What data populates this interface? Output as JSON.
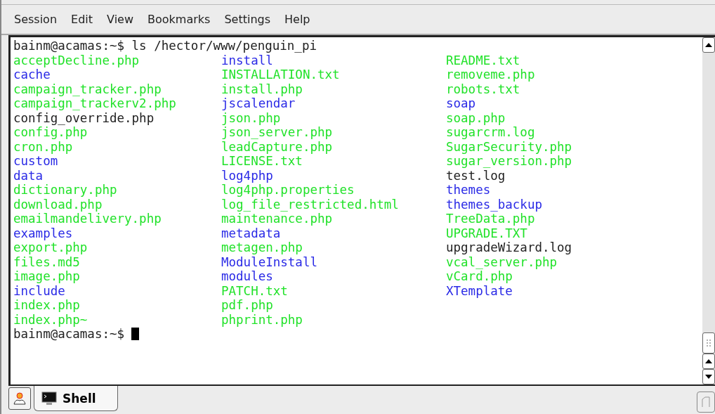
{
  "menu": [
    "Session",
    "Edit",
    "View",
    "Bookmarks",
    "Settings",
    "Help"
  ],
  "terminal": {
    "command_line": "bainm@acamas:~$ ls /hector/www/penguin_pi",
    "prompt": "bainm@acamas:~$",
    "columns": [
      [
        {
          "name": "acceptDecline.php",
          "color": "#22e22a"
        },
        {
          "name": "cache",
          "color": "#2a2ae6"
        },
        {
          "name": "campaign_tracker.php",
          "color": "#22e22a"
        },
        {
          "name": "campaign_trackerv2.php",
          "color": "#22e22a"
        },
        {
          "name": "config_override.php",
          "color": "#222222"
        },
        {
          "name": "config.php",
          "color": "#22e22a"
        },
        {
          "name": "cron.php",
          "color": "#22e22a"
        },
        {
          "name": "custom",
          "color": "#2a2ae6"
        },
        {
          "name": "data",
          "color": "#2a2ae6"
        },
        {
          "name": "dictionary.php",
          "color": "#22e22a"
        },
        {
          "name": "download.php",
          "color": "#22e22a"
        },
        {
          "name": "emailmandelivery.php",
          "color": "#22e22a"
        },
        {
          "name": "examples",
          "color": "#2a2ae6"
        },
        {
          "name": "export.php",
          "color": "#22e22a"
        },
        {
          "name": "files.md5",
          "color": "#22e22a"
        },
        {
          "name": "image.php",
          "color": "#22e22a"
        },
        {
          "name": "include",
          "color": "#2a2ae6"
        },
        {
          "name": "index.php",
          "color": "#22e22a"
        },
        {
          "name": "index.php~",
          "color": "#22e22a"
        }
      ],
      [
        {
          "name": "install",
          "color": "#2a2ae6"
        },
        {
          "name": "INSTALLATION.txt",
          "color": "#22e22a"
        },
        {
          "name": "install.php",
          "color": "#22e22a"
        },
        {
          "name": "jscalendar",
          "color": "#2a2ae6"
        },
        {
          "name": "json.php",
          "color": "#22e22a"
        },
        {
          "name": "json_server.php",
          "color": "#22e22a"
        },
        {
          "name": "leadCapture.php",
          "color": "#22e22a"
        },
        {
          "name": "LICENSE.txt",
          "color": "#22e22a"
        },
        {
          "name": "log4php",
          "color": "#2a2ae6"
        },
        {
          "name": "log4php.properties",
          "color": "#22e22a"
        },
        {
          "name": "log_file_restricted.html",
          "color": "#22e22a"
        },
        {
          "name": "maintenance.php",
          "color": "#22e22a"
        },
        {
          "name": "metadata",
          "color": "#2a2ae6"
        },
        {
          "name": "metagen.php",
          "color": "#22e22a"
        },
        {
          "name": "ModuleInstall",
          "color": "#2a2ae6"
        },
        {
          "name": "modules",
          "color": "#2a2ae6"
        },
        {
          "name": "PATCH.txt",
          "color": "#22e22a"
        },
        {
          "name": "pdf.php",
          "color": "#22e22a"
        },
        {
          "name": "phprint.php",
          "color": "#22e22a"
        }
      ],
      [
        {
          "name": "README.txt",
          "color": "#22e22a"
        },
        {
          "name": "removeme.php",
          "color": "#22e22a"
        },
        {
          "name": "robots.txt",
          "color": "#22e22a"
        },
        {
          "name": "soap",
          "color": "#2a2ae6"
        },
        {
          "name": "soap.php",
          "color": "#22e22a"
        },
        {
          "name": "sugarcrm.log",
          "color": "#22e22a"
        },
        {
          "name": "SugarSecurity.php",
          "color": "#22e22a"
        },
        {
          "name": "sugar_version.php",
          "color": "#22e22a"
        },
        {
          "name": "test.log",
          "color": "#222222"
        },
        {
          "name": "themes",
          "color": "#2a2ae6"
        },
        {
          "name": "themes_backup",
          "color": "#2a2ae6"
        },
        {
          "name": "TreeData.php",
          "color": "#22e22a"
        },
        {
          "name": "UPGRADE.TXT",
          "color": "#22e22a"
        },
        {
          "name": "upgradeWizard.log",
          "color": "#222222"
        },
        {
          "name": "vcal_server.php",
          "color": "#22e22a"
        },
        {
          "name": "vCard.php",
          "color": "#22e22a"
        },
        {
          "name": "XTemplate",
          "color": "#2a2ae6"
        }
      ]
    ]
  },
  "tabs": [
    {
      "label": "Shell",
      "selected": true
    }
  ]
}
